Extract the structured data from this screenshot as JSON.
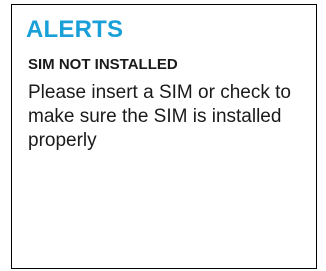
{
  "alerts": {
    "title": "ALERTS",
    "subtitle": "SIM NOT INSTALLED",
    "message": "Please insert a SIM or check to make sure the SIM is installed properly",
    "title_color": "#1aa0d8",
    "text_color": "#1a1a1a"
  }
}
